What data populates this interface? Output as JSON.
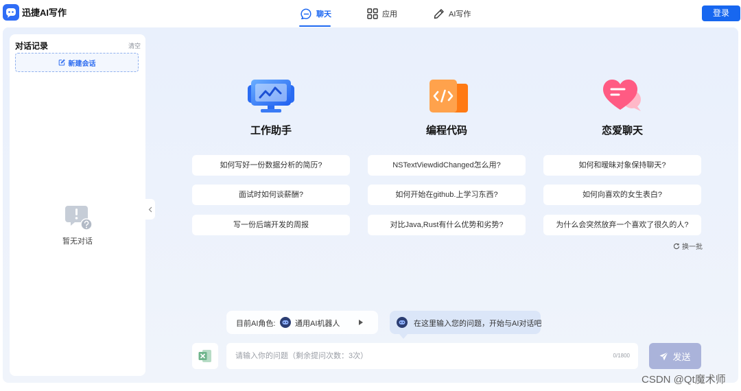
{
  "app": {
    "name": "迅捷AI写作",
    "logo_icon": "chat-bot-logo-icon"
  },
  "nav": {
    "tabs": [
      {
        "label": "聊天",
        "icon": "chat-icon",
        "active": true
      },
      {
        "label": "应用",
        "icon": "grid-icon",
        "active": false
      },
      {
        "label": "AI写作",
        "icon": "pen-icon",
        "active": false
      }
    ],
    "login_label": "登录"
  },
  "sidebar": {
    "title": "对话记录",
    "clear_label": "清空",
    "new_chat_label": "新建会话",
    "new_chat_icon": "edit-icon",
    "empty_icon": "empty-chat-icon",
    "empty_text": "暂无对话",
    "collapse_icon": "chevron-left-icon"
  },
  "categories": [
    {
      "title": "工作助手",
      "icon": "monitor-chart-icon",
      "questions": [
        "如何写好一份数据分析的简历?",
        "面试时如何谈薪酬?",
        "写一份后端开发的周报"
      ]
    },
    {
      "title": "编程代码",
      "icon": "code-file-icon",
      "questions": [
        "NSTextViewdidChanged怎么用?",
        "如何开始在github.上学习东西?",
        "对比Java,Rust有什么优势和劣势?"
      ]
    },
    {
      "title": "恋爱聊天",
      "icon": "heart-chat-icon",
      "questions": [
        "如何和暧昧对象保持聊天?",
        "如何向喜欢的女生表白?",
        "为什么会突然放弃一个喜欢了很久的人?"
      ]
    }
  ],
  "refresh": {
    "label": "换一批",
    "icon": "refresh-icon"
  },
  "role": {
    "prefix": "目前AI角色:",
    "name": "通用AI机器人",
    "avatar_icon": "robot-icon",
    "arrow_icon": "play-triangle-icon"
  },
  "hint": {
    "text": "在这里输入您的问题，开始与AI对话吧",
    "avatar_icon": "robot-icon"
  },
  "composer": {
    "attach_icon": "excel-icon",
    "placeholder": "请输入你的问题（剩余提问次数：3次）",
    "value": "",
    "counter": "0/1800",
    "send_label": "发送",
    "send_icon": "paper-plane-icon"
  },
  "watermark": "CSDN @Qt魔术师",
  "colors": {
    "brand": "#1d68f1",
    "login_bg": "#1767f0",
    "panel_bg": "#eef3fc",
    "send_disabled": "#aab3da",
    "hint_bg": "#dbe6f8"
  }
}
